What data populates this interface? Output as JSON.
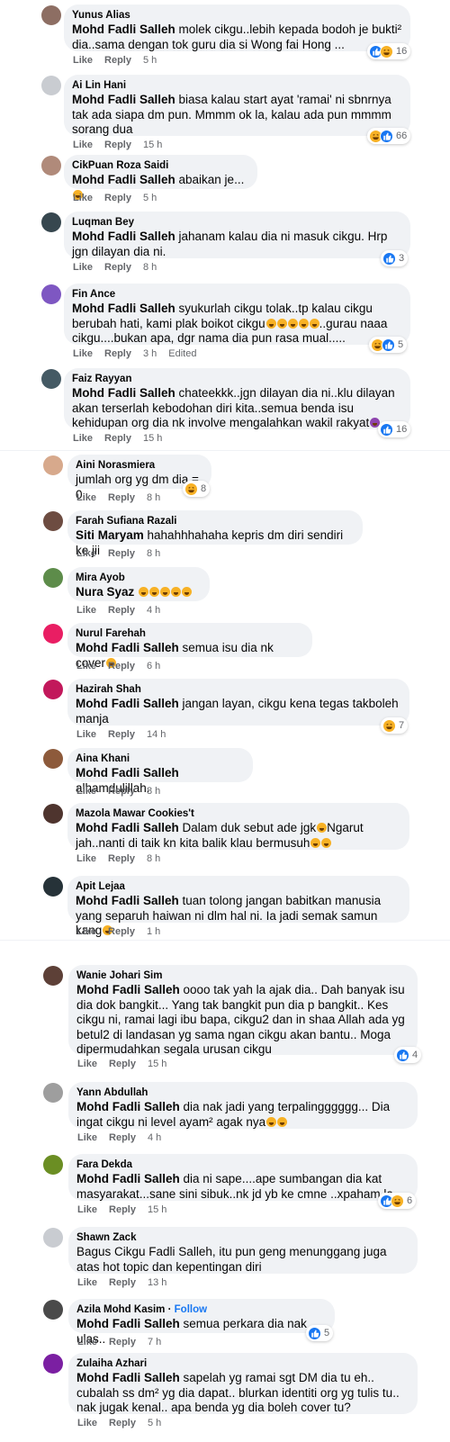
{
  "colors": {
    "bubble": "#f0f2f5",
    "meta": "#65676b",
    "like_blue": "#1877f2",
    "haha_yellow": "#f7b125"
  },
  "actions": {
    "like": "Like",
    "reply": "Reply",
    "edited": "Edited",
    "follow": "Follow"
  },
  "comments": [
    {
      "author": "Yunus Alias",
      "mention": "Mohd Fadli Salleh",
      "text": " molek cikgu..lebih kepada bodoh je bukti² dia..sama dengan tok guru dia si Wong fai Hong ...",
      "emojis": 0,
      "time": "5 h",
      "reactions": {
        "icons": [
          "like-icon",
          "haha-icon"
        ],
        "count": "16"
      },
      "avatar_color": "#8d6e63"
    },
    {
      "author": "Ai Lin Hani",
      "mention": "Mohd Fadli Salleh",
      "text": " biasa kalau start ayat 'ramai' ni sbnrnya tak ada siapa dm pun. Mmmm ok la, kalau ada pun mmmm sorang dua",
      "emojis": 0,
      "time": "15 h",
      "reactions": {
        "icons": [
          "haha-icon",
          "like-icon"
        ],
        "count": "66"
      },
      "avatar_color": "#c9ccd1"
    },
    {
      "author": "CikPuan Roza Saidi",
      "mention": "Mohd Fadli Salleh",
      "text": " abaikan je...",
      "emojis": 1,
      "time": "5 h",
      "avatar_color": "#b08a7a"
    },
    {
      "author": "Luqman Bey",
      "mention": "Mohd Fadli Salleh",
      "text": " jahanam kalau dia ni masuk cikgu. Hrp jgn dilayan dia ni.",
      "emojis": 0,
      "time": "8 h",
      "reactions": {
        "icons": [
          "like-icon"
        ],
        "count": "3"
      },
      "avatar_color": "#37474f"
    },
    {
      "author": "Fin Ance",
      "mention": "Mohd Fadli Salleh",
      "text": " syukurlah cikgu tolak..tp kalau cikgu berubah hati, kami plak boikot cikgu",
      "text2": "..gurau naaa cikgu....bukan apa, dgr nama dia pun rasa mual.....",
      "emojis": 5,
      "time": "3 h",
      "edited": true,
      "reactions": {
        "icons": [
          "haha-icon",
          "like-icon"
        ],
        "count": "5"
      },
      "avatar_color": "#7e57c2"
    },
    {
      "author": "Faiz Rayyan",
      "mention": "Mohd Fadli Salleh",
      "text": " chateekkk..jgn dilayan dia ni..klu dilayan akan terserlah kebodohan diri kita..semua benda isu kehidupan org dia nk involve mengalahkan wakil rakyat",
      "emojis": 1,
      "emoji_purple": true,
      "time": "15 h",
      "reactions": {
        "icons": [
          "like-icon"
        ],
        "count": "16"
      },
      "avatar_color": "#455a64"
    },
    {
      "author": "Aini Norasmiera",
      "mention": "",
      "text": "jumlah org yg dm dia = 0",
      "emojis": 0,
      "time": "8 h",
      "reactions": {
        "icons": [
          "haha-icon"
        ],
        "count": "8"
      },
      "avatar_color": "#d7a98c"
    },
    {
      "author": "Farah Sufiana Razali",
      "mention": "Siti Maryam",
      "text": " hahahhhahaha kepris dm diri sendiri ke jii",
      "emojis": 0,
      "time": "8 h",
      "avatar_color": "#6d4c41"
    },
    {
      "author": "Mira Ayob",
      "mention": "Nura Syaz",
      "text": " ",
      "emojis": 5,
      "time": "4 h",
      "avatar_color": "#5d8c4a"
    },
    {
      "author": "Nurul Farehah",
      "mention": "Mohd Fadli Salleh",
      "text": " semua isu dia nk cover",
      "emojis": 1,
      "time": "6 h",
      "avatar_color": "#e91e63"
    },
    {
      "author": "Hazirah Shah",
      "mention": "Mohd Fadli Salleh",
      "text": " jangan layan, cikgu kena tegas takboleh manja",
      "emojis": 0,
      "time": "14 h",
      "reactions": {
        "icons": [
          "haha-icon"
        ],
        "count": "7"
      },
      "avatar_color": "#c2185b"
    },
    {
      "author": "Aina Khani",
      "mention": "Mohd Fadli Salleh",
      "text": " alhamdulillah.",
      "emojis": 0,
      "time": "8 h",
      "avatar_color": "#8d5a3b"
    },
    {
      "author": "Mazola Mawar Cookies't",
      "mention": "Mohd Fadli Salleh",
      "text": " Dalam duk sebut ade jgk",
      "text2": "Ngarut jah..nanti di taik kn kita balik klau bermusuh",
      "emojis": 1,
      "emojis_end": 2,
      "time": "8 h",
      "avatar_color": "#4e342e"
    },
    {
      "author": "Apit Lejaa",
      "mention": "Mohd Fadli Salleh",
      "text": " tuan tolong jangan babitkan manusia yang separuh haiwan ni dlm hal ni. Ia jadi semak samun kang",
      "emojis": 1,
      "time": "1 h",
      "avatar_color": "#263238"
    },
    {
      "author": "Wanie Johari Sim",
      "mention": "Mohd Fadli Salleh",
      "text": " oooo tak yah la ajak dia.. Dah banyak isu dia dok bangkit... Yang tak bangkit pun dia p bangkit.. Kes cikgu ni, ramai lagi ibu bapa, cikgu2 dan in shaa Allah ada yg betul2 di landasan yg sama ngan cikgu akan bantu.. Moga dipermudahkan segala urusan cikgu",
      "emojis": 0,
      "time": "15 h",
      "reactions": {
        "icons": [
          "like-icon"
        ],
        "count": "4"
      },
      "avatar_color": "#5d4037"
    },
    {
      "author": "Yann Abdullah",
      "mention": "Mohd Fadli Salleh",
      "text": " dia nak jadi yang terpalingggggg... Dia ingat cikgu ni level ayam² agak nya",
      "emojis": 2,
      "time": "4 h",
      "avatar_color": "#9e9e9e"
    },
    {
      "author": "Fara Dekda",
      "mention": "Mohd Fadli Salleh",
      "text": " dia ni sape....ape sumbangan dia kat masyarakat...sane sini sibuk..nk jd yb ke cmne ..xpaham la",
      "emojis": 0,
      "time": "15 h",
      "reactions": {
        "icons": [
          "like-icon",
          "haha-icon"
        ],
        "count": "6"
      },
      "avatar_color": "#6b8e23"
    },
    {
      "author": "Shawn Zack",
      "mention": "",
      "text": "Bagus Cikgu Fadli Salleh, itu pun geng menunggang juga atas hot topic dan kepentingan diri",
      "emojis": 0,
      "time": "13 h",
      "avatar_color": "#c9ccd1"
    },
    {
      "author": "Azila Mohd Kasim",
      "mention": "Mohd Fadli Salleh",
      "text": " semua perkara dia nak ulas..",
      "emojis": 0,
      "time": "7 h",
      "follow": true,
      "reactions": {
        "icons": [
          "like-icon"
        ],
        "count": "5"
      },
      "avatar_color": "#4a4a4a"
    },
    {
      "author": "Zulaiha Azhari",
      "mention": "Mohd Fadli Salleh",
      "text": " sapelah yg ramai sgt DM dia tu eh.. cubalah ss dm² yg dia dapat.. blurkan identiti org yg tulis tu.. nak jugak kenal.. apa benda yg dia boleh cover tu?",
      "emojis": 0,
      "time": "5 h",
      "avatar_color": "#7b1fa2"
    }
  ]
}
